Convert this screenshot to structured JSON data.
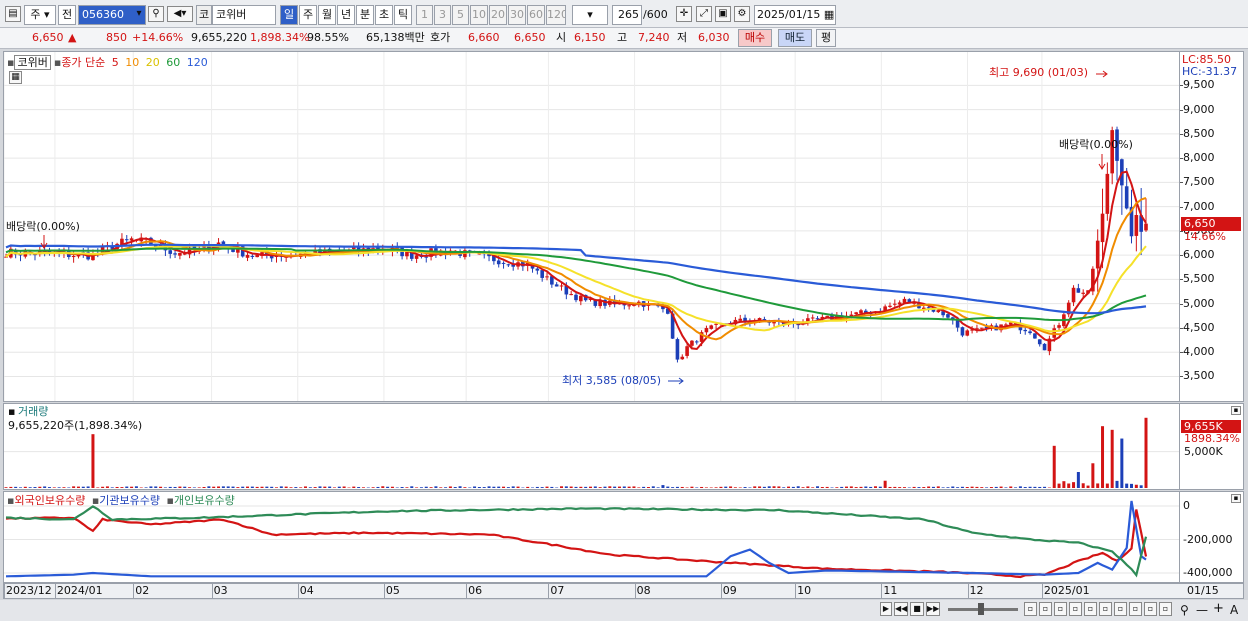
{
  "toolbar": {
    "market": "주",
    "prev_label": "전",
    "code": "056360",
    "type_label": "코",
    "name": "코위버",
    "periods": [
      "일",
      "주",
      "월",
      "년",
      "분",
      "초",
      "틱"
    ],
    "period_active": "일",
    "intervals": [
      "1",
      "3",
      "5",
      "10",
      "20",
      "30",
      "60",
      "120"
    ],
    "count": "265",
    "count_max": "/600",
    "date": "2025/01/15"
  },
  "quote": {
    "price": "6,650",
    "arrow": "▲",
    "change": "850",
    "change_pct": "+14.66%",
    "volume": "9,655,220",
    "vol_ratio": "1,898.34%",
    "turnover": "98.55%",
    "amount": "65,138백만",
    "hoga_label": "호가",
    "hoga1": "6,660",
    "hoga2": "6,650",
    "open_label": "시",
    "open": "6,150",
    "high_label": "고",
    "high": "7,240",
    "low_label": "저",
    "low": "6,030",
    "buy_label": "매수",
    "sell_label": "매도",
    "eval_label": "평"
  },
  "colors": {
    "up": "#d31414",
    "down": "#1c3fb8",
    "ma5": "#d31414",
    "ma10": "#f08c00",
    "ma20": "#f5e12a",
    "ma60": "#1f9a3a",
    "ma120": "#2a5bd7",
    "foreign": "#d31414",
    "inst": "#2a5bd7",
    "indiv": "#2e8b57"
  },
  "chart_data": [
    {
      "type": "candlestick",
      "name_label": "코위버",
      "legend_prefix": "종가 단순",
      "ma_periods": [
        "5",
        "10",
        "20",
        "60",
        "120"
      ],
      "corner_lc": "LC:85.50",
      "corner_hc": "HC:-31.37",
      "ylim": [
        3200,
        9900
      ],
      "yticks": [
        3500,
        4000,
        4500,
        5000,
        5500,
        6000,
        6500,
        7000,
        7500,
        8000,
        8500,
        9000,
        9500
      ],
      "ytick_labels": [
        "3,500",
        "4,000",
        "4,500",
        "5,000",
        "5,500",
        "6,000",
        "6,500",
        "7,000",
        "7,500",
        "8,000",
        "8,500",
        "9,000",
        "9,500"
      ],
      "last_price_label": "6,650",
      "last_pct_label": "14.66%",
      "last_price": 6650,
      "anno_high": "최고 9,690 (01/03)",
      "anno_low": "최저 3,585 (08/05)",
      "anno_div1": "배당락(0.00%)",
      "anno_div2": "배당락(0.00%)",
      "close_keyframes": [
        [
          0,
          6060
        ],
        [
          10,
          6020
        ],
        [
          18,
          5990
        ],
        [
          22,
          6200
        ],
        [
          26,
          6320
        ],
        [
          30,
          6250
        ],
        [
          35,
          6050
        ],
        [
          40,
          6100
        ],
        [
          44,
          6250
        ],
        [
          48,
          6080
        ],
        [
          52,
          5980
        ],
        [
          56,
          6000
        ],
        [
          62,
          6030
        ],
        [
          68,
          6040
        ],
        [
          72,
          6080
        ],
        [
          78,
          6150
        ],
        [
          84,
          6000
        ],
        [
          88,
          6050
        ],
        [
          92,
          6100
        ],
        [
          96,
          6000
        ],
        [
          102,
          5900
        ],
        [
          108,
          5800
        ],
        [
          112,
          5500
        ],
        [
          116,
          5250
        ],
        [
          120,
          5050
        ],
        [
          126,
          4980
        ],
        [
          131,
          5030
        ],
        [
          137,
          4860
        ],
        [
          139,
          3800
        ],
        [
          141,
          4100
        ],
        [
          145,
          4450
        ],
        [
          150,
          4630
        ],
        [
          156,
          4650
        ],
        [
          162,
          4580
        ],
        [
          168,
          4660
        ],
        [
          174,
          4750
        ],
        [
          180,
          4850
        ],
        [
          186,
          5060
        ],
        [
          191,
          4920
        ],
        [
          195,
          4750
        ],
        [
          198,
          4400
        ],
        [
          202,
          4450
        ],
        [
          208,
          4580
        ],
        [
          212,
          4450
        ],
        [
          215,
          4100
        ],
        [
          218,
          4600
        ],
        [
          221,
          5300
        ],
        [
          224,
          5200
        ],
        [
          227,
          6800
        ],
        [
          229,
          8600
        ],
        [
          231,
          7500
        ],
        [
          233,
          6300
        ],
        [
          234,
          6900
        ],
        [
          235,
          6400
        ],
        [
          236,
          6650
        ]
      ],
      "volume": {
        "title": "거래량",
        "readout": "9,655,220주(1,898.34%)",
        "last_label": "9,655K",
        "last_pct": "1898.34%",
        "ytick_label": "5,000K",
        "ylim": [
          0,
          11000
        ],
        "spikes": [
          [
            18,
            7400
          ],
          [
            136,
            400
          ],
          [
            182,
            1000
          ],
          [
            217,
            5800
          ],
          [
            222,
            2200
          ],
          [
            225,
            3400
          ],
          [
            227,
            8500
          ],
          [
            229,
            8000
          ],
          [
            231,
            6800
          ],
          [
            236,
            9655
          ]
        ]
      }
    },
    {
      "type": "line",
      "legend": [
        "외국인보유수량",
        "기관보유수량",
        "개인보유수량"
      ],
      "ylim": [
        -430000,
        60000
      ],
      "yticks": [
        0,
        -200000,
        -400000
      ],
      "ytick_labels": [
        "0",
        "-200,000",
        "-400,000"
      ],
      "series": [
        {
          "name": "외국인보유수량",
          "keyframes": [
            [
              0,
              -75000
            ],
            [
              14,
              -70000
            ],
            [
              18,
              -150000
            ],
            [
              20,
              -80000
            ],
            [
              30,
              -110000
            ],
            [
              45,
              -80000
            ],
            [
              55,
              -170000
            ],
            [
              75,
              -160000
            ],
            [
              100,
              -170000
            ],
            [
              115,
              -240000
            ],
            [
              125,
              -290000
            ],
            [
              145,
              -330000
            ],
            [
              170,
              -375000
            ],
            [
              195,
              -395000
            ],
            [
              205,
              -410000
            ],
            [
              210,
              -420000
            ],
            [
              215,
              -410000
            ],
            [
              222,
              -330000
            ],
            [
              227,
              -280000
            ],
            [
              230,
              -330000
            ],
            [
              233,
              -250000
            ],
            [
              234,
              -20000
            ],
            [
              236,
              -300000
            ]
          ]
        },
        {
          "name": "기관보유수량",
          "keyframes": [
            [
              0,
              -420000
            ],
            [
              14,
              -410000
            ],
            [
              18,
              -400000
            ],
            [
              30,
              -420000
            ],
            [
              80,
              -420000
            ],
            [
              145,
              -420000
            ],
            [
              150,
              -300000
            ],
            [
              154,
              -260000
            ],
            [
              158,
              -340000
            ],
            [
              162,
              -400000
            ],
            [
              170,
              -385000
            ],
            [
              200,
              -400000
            ],
            [
              215,
              -410000
            ],
            [
              222,
              -400000
            ],
            [
              226,
              -340000
            ],
            [
              229,
              -380000
            ],
            [
              232,
              -250000
            ],
            [
              233,
              30000
            ],
            [
              235,
              -300000
            ],
            [
              236,
              -320000
            ]
          ]
        },
        {
          "name": "개인보유수량",
          "keyframes": [
            [
              0,
              -70000
            ],
            [
              14,
              -80000
            ],
            [
              18,
              0
            ],
            [
              22,
              -80000
            ],
            [
              40,
              -70000
            ],
            [
              80,
              -30000
            ],
            [
              120,
              -15000
            ],
            [
              160,
              -25000
            ],
            [
              190,
              -80000
            ],
            [
              200,
              -160000
            ],
            [
              212,
              -200000
            ],
            [
              222,
              -220000
            ],
            [
              226,
              -250000
            ],
            [
              229,
              -270000
            ],
            [
              232,
              -350000
            ],
            [
              234,
              -410000
            ],
            [
              236,
              -180000
            ]
          ]
        }
      ]
    }
  ],
  "xaxis": {
    "labels": [
      {
        "i": 0,
        "t": "2023/12"
      },
      {
        "i": 13,
        "t": "2024/01"
      },
      {
        "i": 33,
        "t": "02"
      },
      {
        "i": 53,
        "t": "03"
      },
      {
        "i": 75,
        "t": "04"
      },
      {
        "i": 97,
        "t": "05"
      },
      {
        "i": 118,
        "t": "06"
      },
      {
        "i": 139,
        "t": "07"
      },
      {
        "i": 161,
        "t": "08"
      },
      {
        "i": 183,
        "t": "09"
      },
      {
        "i": 202,
        "t": "10"
      },
      {
        "i": 224,
        "t": "11"
      },
      {
        "i": 246,
        "t": "12"
      },
      {
        "i": 265,
        "t": "2025/01"
      }
    ],
    "end_label": "01/15"
  }
}
